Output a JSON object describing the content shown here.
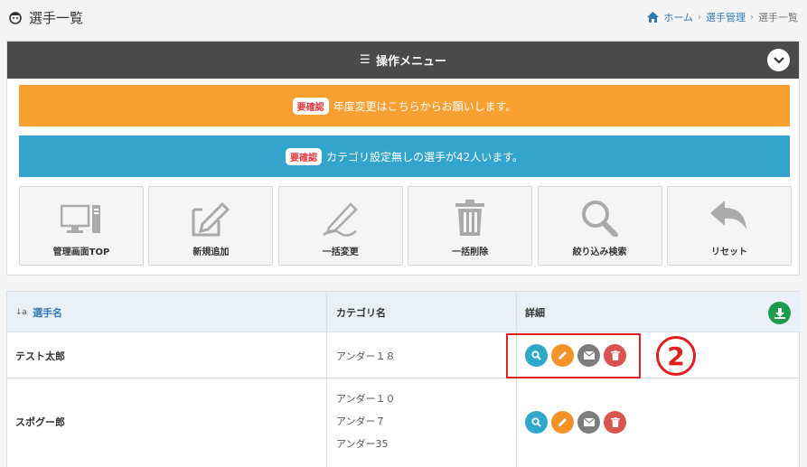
{
  "header": {
    "title": "選手一覧",
    "breadcrumb": [
      "ホーム",
      "選手管理",
      "選手一覧"
    ]
  },
  "menu": {
    "title": "操作メニュー",
    "notices": [
      {
        "badge": "要確認",
        "text": "年度変更はこちらからお願いします。",
        "color": "#f9a033"
      },
      {
        "badge": "要確認",
        "text": "カテゴリ設定無しの選手が42人います。",
        "color": "#33a5cc"
      }
    ],
    "tiles": [
      {
        "label": "管理画面TOP",
        "icon": "monitor-icon"
      },
      {
        "label": "新規追加",
        "icon": "edit-icon"
      },
      {
        "label": "一括変更",
        "icon": "pen-icon"
      },
      {
        "label": "一括削除",
        "icon": "trash-icon"
      },
      {
        "label": "絞り込み検索",
        "icon": "search-icon"
      },
      {
        "label": "リセット",
        "icon": "undo-icon"
      }
    ]
  },
  "table": {
    "columns": {
      "sort_icon": "↓a",
      "name": "選手名",
      "category": "カテゴリ名",
      "detail": "詳細"
    },
    "rows": [
      {
        "name": "テスト太郎",
        "categories": [
          "アンダー１８"
        ]
      },
      {
        "name": "スポグー郎",
        "categories": [
          "アンダー１０",
          "アンダー７",
          "アンダー35"
        ]
      }
    ]
  },
  "annotation": {
    "step": "2"
  },
  "colors": {
    "accent": "#337ab7",
    "header_bar": "#4a4a4a",
    "highlight": "#e02020"
  }
}
